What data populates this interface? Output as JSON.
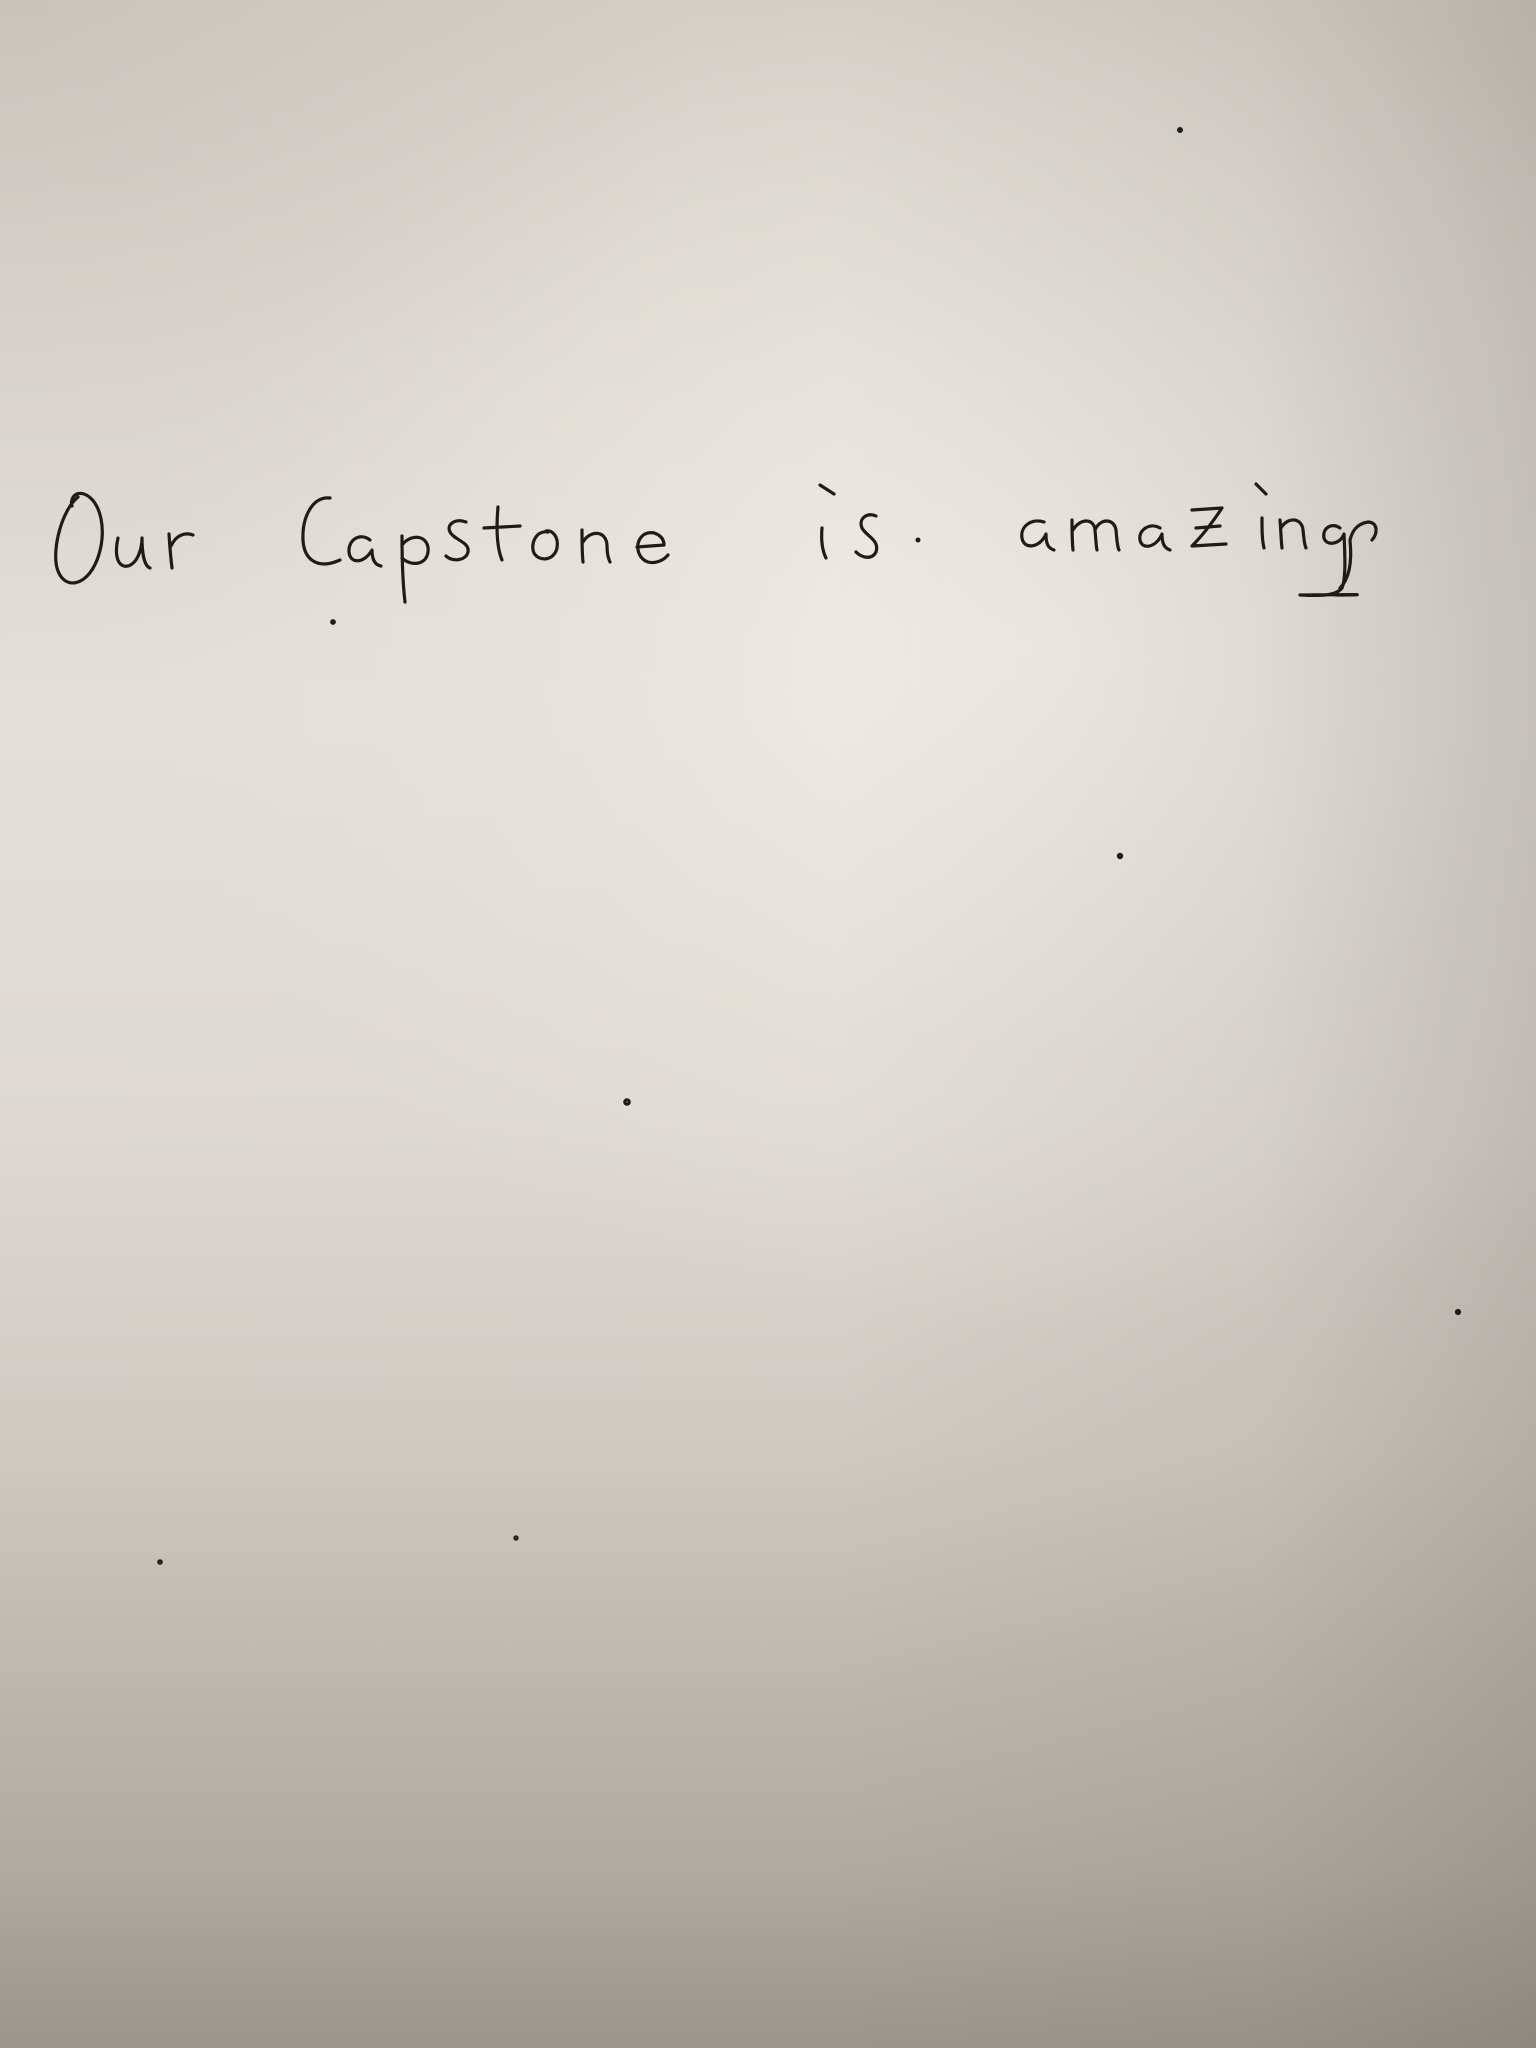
{
  "photo": {
    "subject": "sheet-of-paper",
    "paper_color": "#dedad3",
    "ink_color": "#1f1c18",
    "handwritten_text": "Our Capstone is amazing"
  }
}
